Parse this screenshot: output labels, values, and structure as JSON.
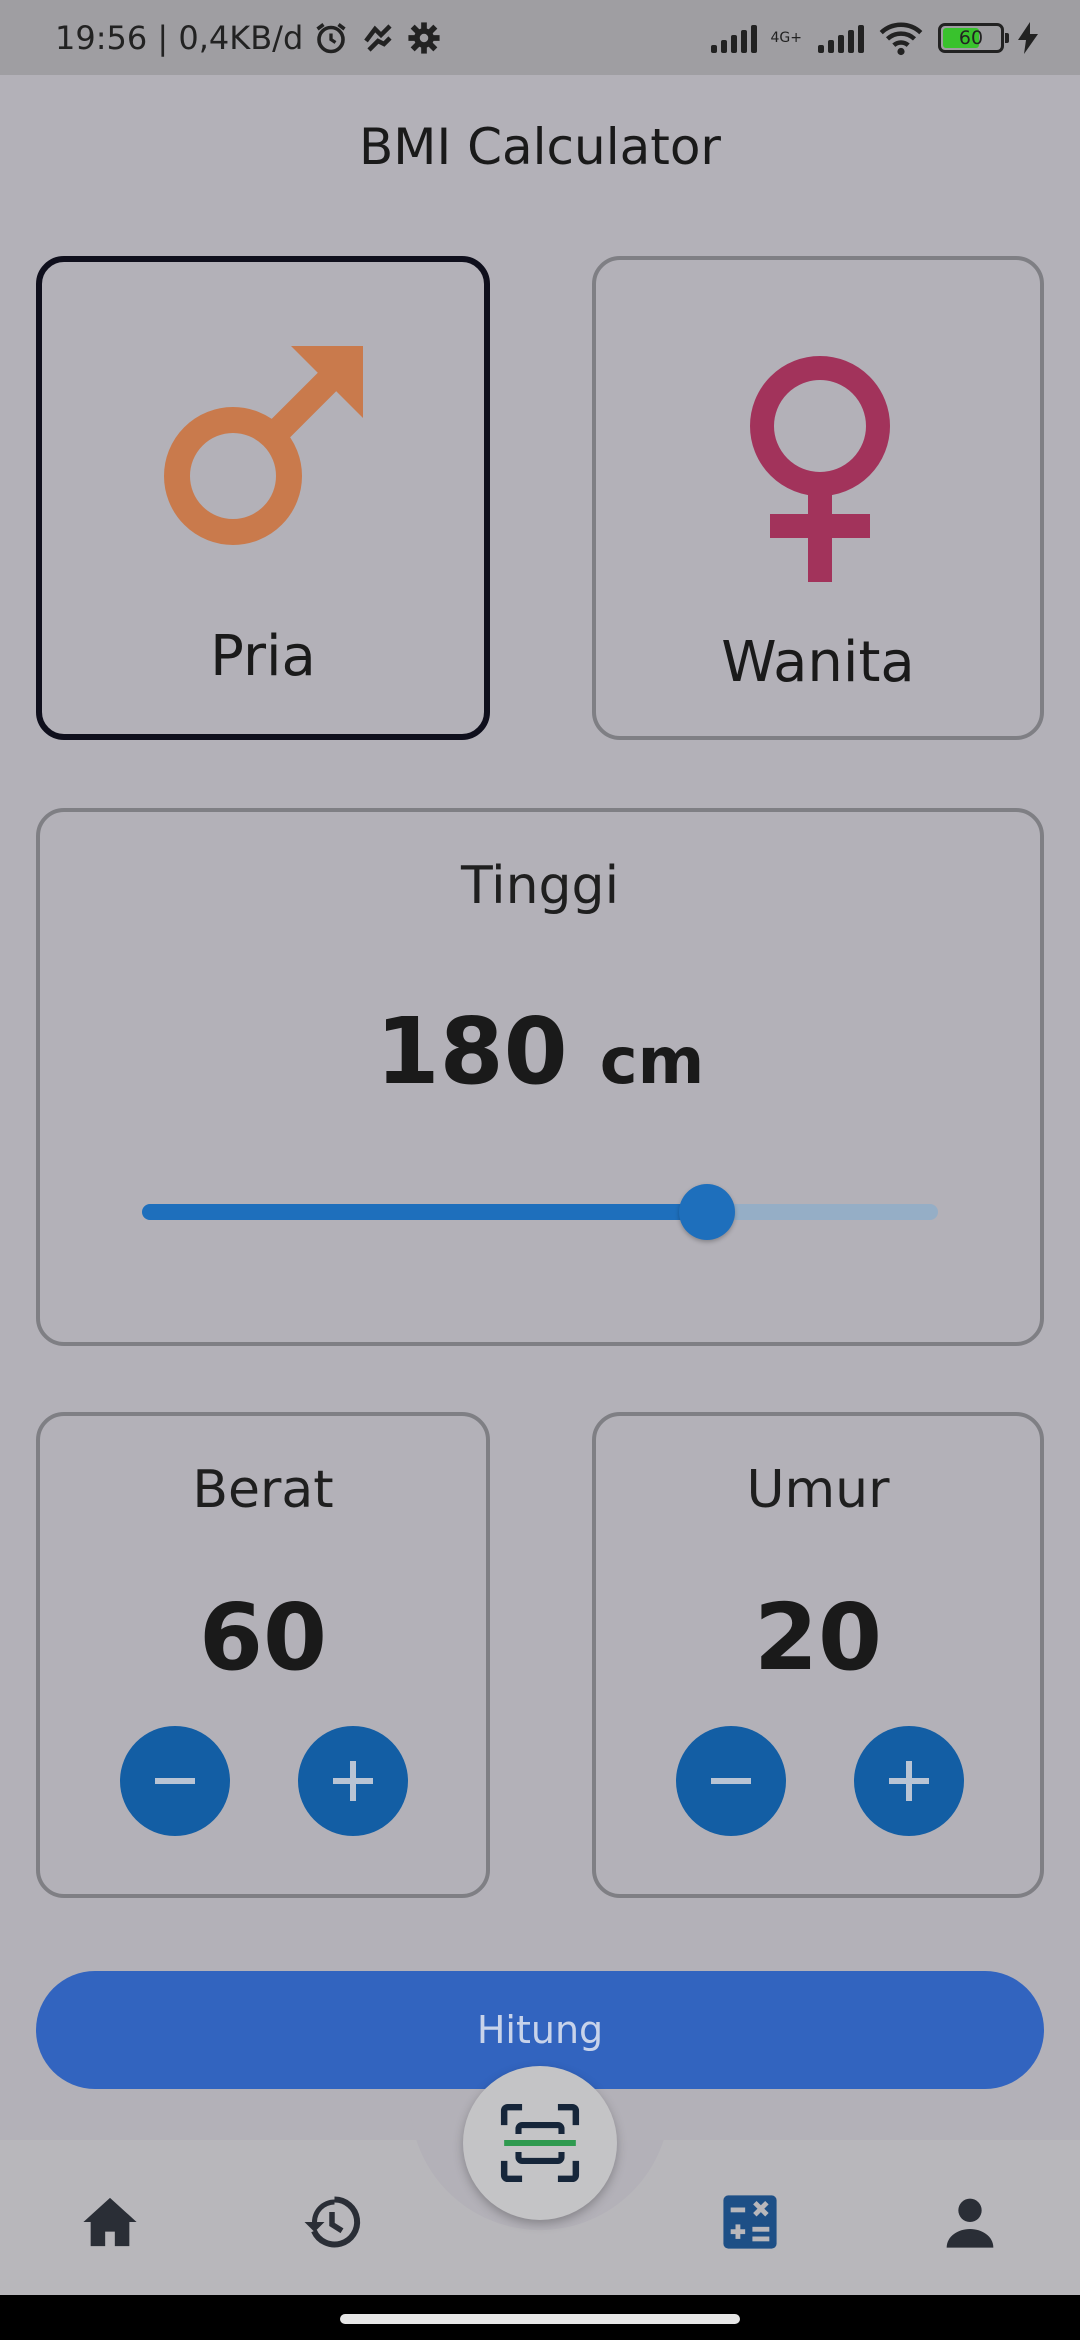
{
  "status_bar": {
    "time_speed": "19:56 | 0,4KB/d",
    "network_tag": "4G+",
    "battery": "60"
  },
  "app": {
    "title": "BMI Calculator"
  },
  "gender": {
    "male_label": "Pria",
    "female_label": "Wanita",
    "selected": "Pria",
    "male_color": "#c97a4c",
    "female_color": "#a2335b"
  },
  "height": {
    "label": "Tinggi",
    "value": "180",
    "unit": "cm",
    "slider_fraction": 0.71
  },
  "weight": {
    "label": "Berat",
    "value": "60"
  },
  "age": {
    "label": "Umur",
    "value": "20"
  },
  "actions": {
    "calculate_label": "Hitung"
  },
  "nav": {
    "items": [
      "home-icon",
      "history-icon",
      "scan-icon",
      "calculator-icon",
      "profile-icon"
    ],
    "active": "calculator-icon"
  },
  "colors": {
    "accent": "#1e6fbc",
    "button_blue": "#3264bf",
    "stepper_blue": "#135ea4"
  }
}
